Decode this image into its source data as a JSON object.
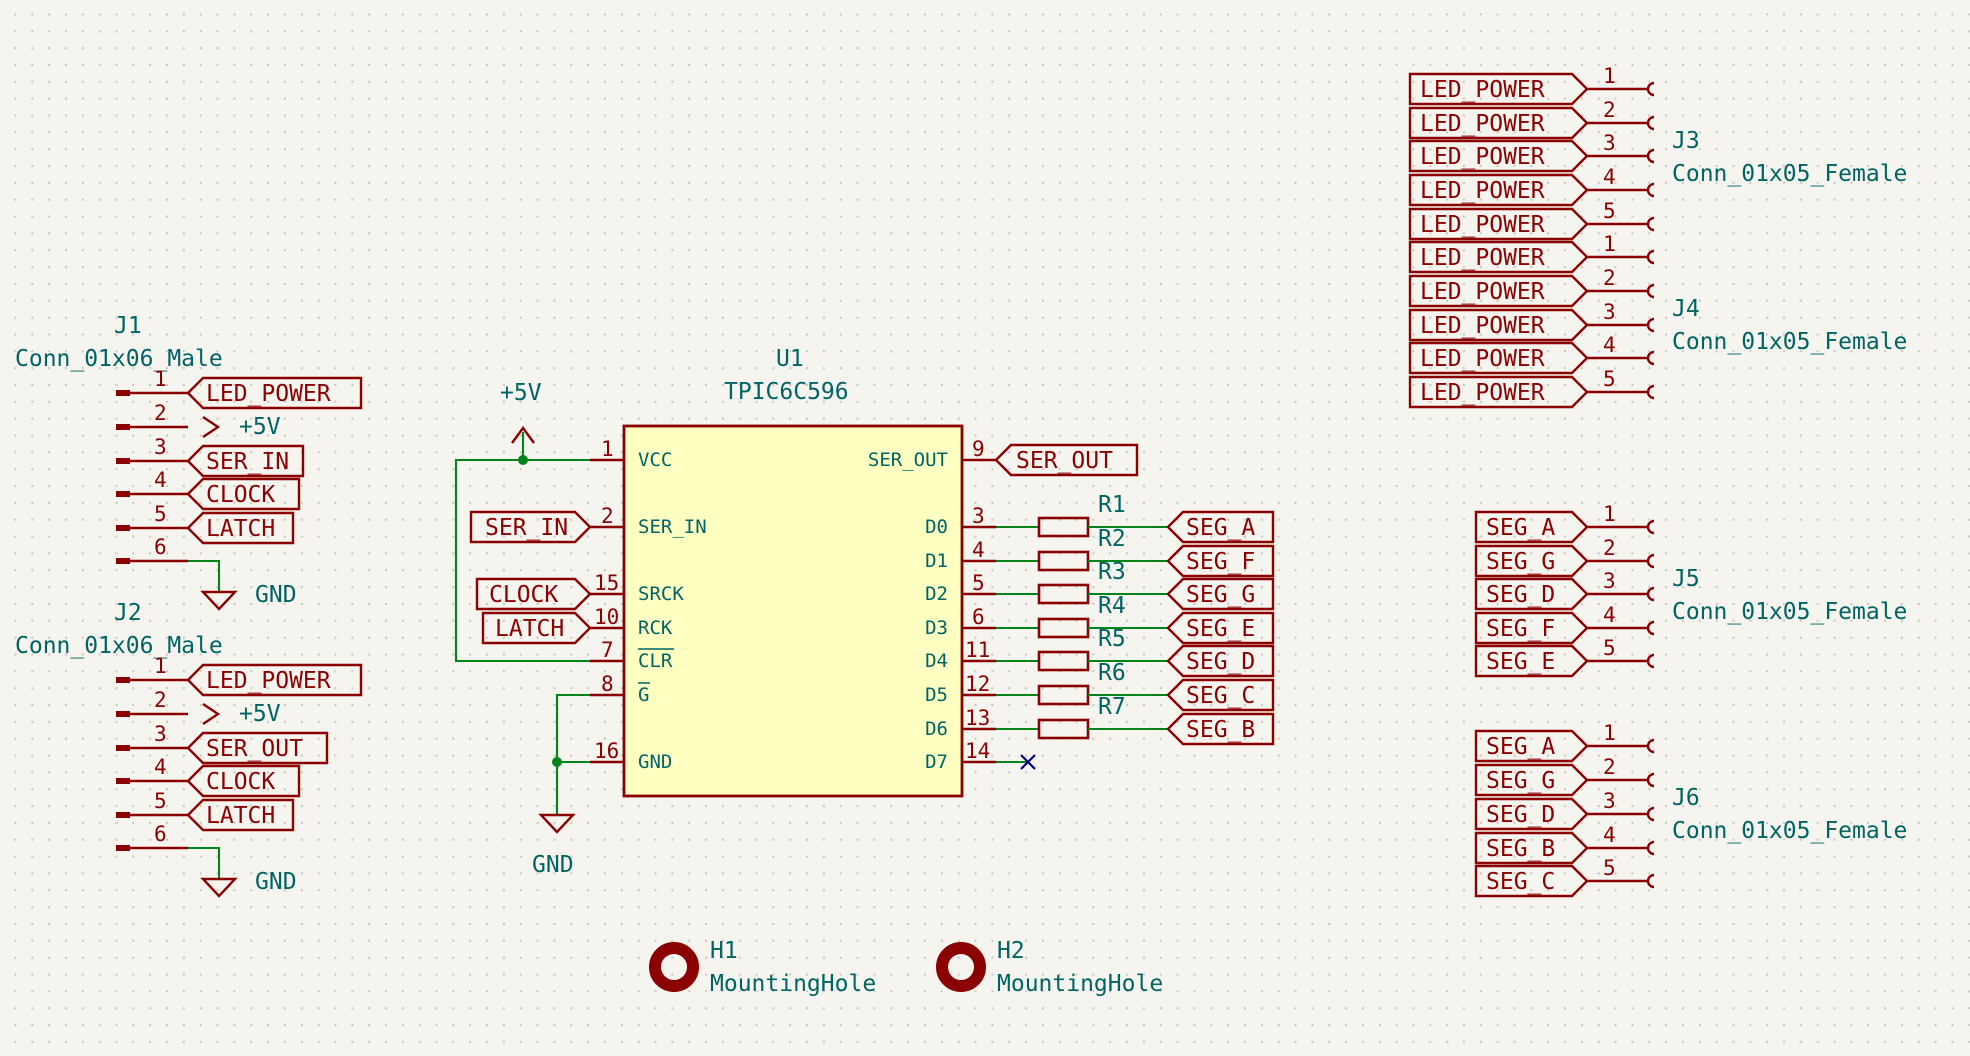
{
  "u1": {
    "ref": "U1",
    "value": "TPIC6C596",
    "left_pins": [
      {
        "num": "1",
        "name": "VCC"
      },
      {
        "num": "2",
        "name": "SER_IN"
      },
      {
        "num": "15",
        "name": "SRCK"
      },
      {
        "num": "10",
        "name": "RCK"
      },
      {
        "num": "7",
        "name": "CLR"
      },
      {
        "num": "8",
        "name": "G"
      },
      {
        "num": "16",
        "name": "GND"
      }
    ],
    "right_pins": [
      {
        "num": "9",
        "name": "SER_OUT"
      },
      {
        "num": "3",
        "name": "D0"
      },
      {
        "num": "4",
        "name": "D1"
      },
      {
        "num": "5",
        "name": "D2"
      },
      {
        "num": "6",
        "name": "D3"
      },
      {
        "num": "11",
        "name": "D4"
      },
      {
        "num": "12",
        "name": "D5"
      },
      {
        "num": "13",
        "name": "D6"
      },
      {
        "num": "14",
        "name": "D7"
      }
    ]
  },
  "u1_power": {
    "vcc": "+5V",
    "gnd": "GND"
  },
  "u1_labels": {
    "ser_in": "SER_IN",
    "clock": "CLOCK",
    "latch": "LATCH",
    "ser_out": "SER_OUT"
  },
  "resistors": [
    {
      "ref": "R1",
      "label": "SEG_A"
    },
    {
      "ref": "R2",
      "label": "SEG_F"
    },
    {
      "ref": "R3",
      "label": "SEG_G"
    },
    {
      "ref": "R4",
      "label": "SEG_E"
    },
    {
      "ref": "R5",
      "label": "SEG_D"
    },
    {
      "ref": "R6",
      "label": "SEG_C"
    },
    {
      "ref": "R7",
      "label": "SEG_B"
    }
  ],
  "j1": {
    "ref": "J1",
    "value": "Conn_01x06_Male",
    "pins": [
      {
        "num": "1",
        "label": "LED_POWER"
      },
      {
        "num": "2",
        "label": "+5V"
      },
      {
        "num": "3",
        "label": "SER_IN"
      },
      {
        "num": "4",
        "label": "CLOCK"
      },
      {
        "num": "5",
        "label": "LATCH"
      },
      {
        "num": "6",
        "label": "GND"
      }
    ]
  },
  "j2": {
    "ref": "J2",
    "value": "Conn_01x06_Male",
    "pins": [
      {
        "num": "1",
        "label": "LED_POWER"
      },
      {
        "num": "2",
        "label": "+5V"
      },
      {
        "num": "3",
        "label": "SER_OUT"
      },
      {
        "num": "4",
        "label": "CLOCK"
      },
      {
        "num": "5",
        "label": "LATCH"
      },
      {
        "num": "6",
        "label": "GND"
      }
    ]
  },
  "j3": {
    "ref": "J3",
    "value": "Conn_01x05_Female",
    "pins": [
      {
        "num": "1",
        "label": "LED_POWER"
      },
      {
        "num": "2",
        "label": "LED_POWER"
      },
      {
        "num": "3",
        "label": "LED_POWER"
      },
      {
        "num": "4",
        "label": "LED_POWER"
      },
      {
        "num": "5",
        "label": "LED_POWER"
      }
    ]
  },
  "j4": {
    "ref": "J4",
    "value": "Conn_01x05_Female",
    "pins": [
      {
        "num": "1",
        "label": "LED_POWER"
      },
      {
        "num": "2",
        "label": "LED_POWER"
      },
      {
        "num": "3",
        "label": "LED_POWER"
      },
      {
        "num": "4",
        "label": "LED_POWER"
      },
      {
        "num": "5",
        "label": "LED_POWER"
      }
    ]
  },
  "j5": {
    "ref": "J5",
    "value": "Conn_01x05_Female",
    "pins": [
      {
        "num": "1",
        "label": "SEG_A"
      },
      {
        "num": "2",
        "label": "SEG_G"
      },
      {
        "num": "3",
        "label": "SEG_D"
      },
      {
        "num": "4",
        "label": "SEG_F"
      },
      {
        "num": "5",
        "label": "SEG_E"
      }
    ]
  },
  "j6": {
    "ref": "J6",
    "value": "Conn_01x05_Female",
    "pins": [
      {
        "num": "1",
        "label": "SEG_A"
      },
      {
        "num": "2",
        "label": "SEG_G"
      },
      {
        "num": "3",
        "label": "SEG_D"
      },
      {
        "num": "4",
        "label": "SEG_B"
      },
      {
        "num": "5",
        "label": "SEG_C"
      }
    ]
  },
  "h1": {
    "ref": "H1",
    "value": "MountingHole"
  },
  "h2": {
    "ref": "H2",
    "value": "MountingHole"
  },
  "colors": {
    "symbol": "#8b0000",
    "text": "#006464",
    "wire": "#00841a",
    "body_fill": "#ffffc2",
    "no_connect": "#000084"
  }
}
